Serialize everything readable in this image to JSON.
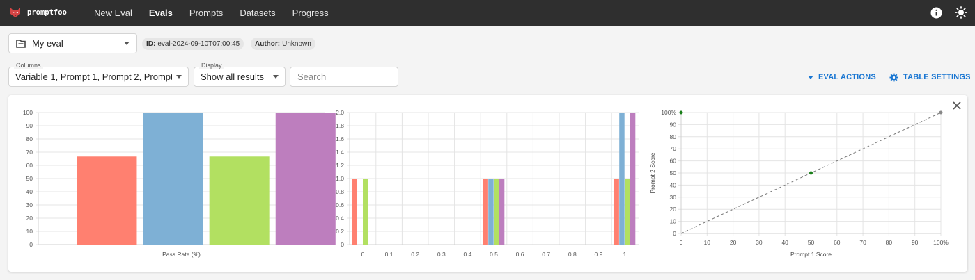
{
  "app": {
    "name": "promptfoo"
  },
  "nav": [
    {
      "label": "New Eval",
      "active": false
    },
    {
      "label": "Evals",
      "active": true
    },
    {
      "label": "Prompts",
      "active": false
    },
    {
      "label": "Datasets",
      "active": false
    },
    {
      "label": "Progress",
      "active": false
    }
  ],
  "top_icons": [
    "info-icon",
    "sun-icon"
  ],
  "eval": {
    "name": "My eval",
    "id_label": "ID:",
    "id_value": "eval-2024-09-10T07:00:45",
    "author_label": "Author:",
    "author_value": "Unknown"
  },
  "filters": {
    "columns_label": "Columns",
    "columns_value": "Variable 1, Prompt 1, Prompt 2, Prompt...",
    "display_label": "Display",
    "display_value": "Show all results",
    "search_placeholder": "Search",
    "eval_actions": "EVAL ACTIONS",
    "table_settings": "TABLE SETTINGS"
  },
  "colors": {
    "series": [
      "#ff8070",
      "#7eb0d5",
      "#b2e061",
      "#bd7ebe"
    ],
    "accent": "#1976d2",
    "scatter_point": "#1a7f1a",
    "scatter_ref": "#888888"
  },
  "chart_data": [
    {
      "type": "bar",
      "xlabel": "Pass Rate (%)",
      "ylim": [
        0,
        100
      ],
      "yticks": [
        0,
        10,
        20,
        30,
        40,
        50,
        60,
        70,
        80,
        90,
        100
      ],
      "values": [
        66.7,
        100,
        66.7,
        100
      ],
      "grid": true
    },
    {
      "type": "bar",
      "ylim": [
        0,
        2.0
      ],
      "yticks": [
        "0",
        "0.2",
        "0.4",
        "0.6",
        "0.8",
        "1.0",
        "1.2",
        "1.4",
        "1.6",
        "1.8",
        "2.0"
      ],
      "xticks": [
        "0",
        "0.1",
        "0.2",
        "0.3",
        "0.4",
        "0.5",
        "0.6",
        "0.7",
        "0.8",
        "0.9",
        "1"
      ],
      "bars": [
        {
          "x": 0,
          "series": 0,
          "value": 1
        },
        {
          "x": 0,
          "series": 2,
          "value": 1
        },
        {
          "x": 0.5,
          "series": 0,
          "value": 1
        },
        {
          "x": 0.5,
          "series": 1,
          "value": 1
        },
        {
          "x": 0.5,
          "series": 2,
          "value": 1
        },
        {
          "x": 0.5,
          "series": 3,
          "value": 1
        },
        {
          "x": 1,
          "series": 0,
          "value": 1
        },
        {
          "x": 1,
          "series": 1,
          "value": 2
        },
        {
          "x": 1,
          "series": 2,
          "value": 1
        },
        {
          "x": 1,
          "series": 3,
          "value": 2
        }
      ],
      "grid": true
    },
    {
      "type": "scatter",
      "xlabel": "Prompt 1 Score",
      "ylabel": "Prompt 2 Score",
      "xticks": [
        "0",
        "10",
        "20",
        "30",
        "40",
        "50",
        "60",
        "70",
        "80",
        "90",
        "100%"
      ],
      "yticks": [
        "0",
        "10",
        "20",
        "30",
        "40",
        "50",
        "60",
        "70",
        "80",
        "90",
        "100%"
      ],
      "xlim": [
        0,
        100
      ],
      "ylim": [
        0,
        100
      ],
      "points": [
        {
          "x": 0,
          "y": 100
        },
        {
          "x": 50,
          "y": 50
        },
        {
          "x": 100,
          "y": 100
        }
      ],
      "reference_line": true,
      "grid": true
    }
  ]
}
